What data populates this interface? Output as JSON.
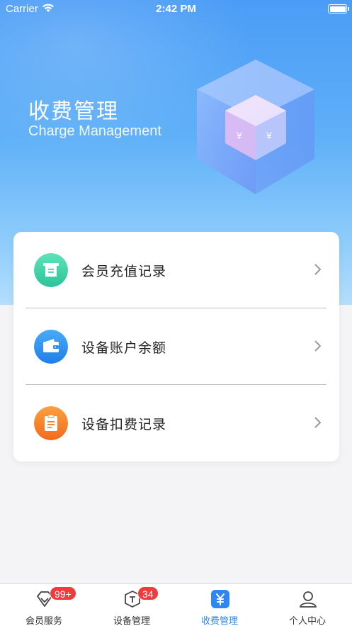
{
  "status_bar": {
    "carrier": "Carrier",
    "time": "2:42 PM"
  },
  "hero": {
    "title": "收费管理",
    "subtitle": "Charge Management",
    "cube_symbol": "¥"
  },
  "menu": {
    "items": [
      {
        "label": "会员充值记录",
        "icon": "receipt-icon",
        "color": "#3fd0a4"
      },
      {
        "label": "设备账户余额",
        "icon": "wallet-icon",
        "color": "#2e8ff0"
      },
      {
        "label": "设备扣费记录",
        "icon": "clipboard-icon",
        "color": "#f7842a"
      }
    ]
  },
  "tabbar": {
    "tabs": [
      {
        "label": "会员服务",
        "icon": "diamond-icon",
        "badge": "99+"
      },
      {
        "label": "设备管理",
        "icon": "device-icon",
        "badge": "34"
      },
      {
        "label": "收费管理",
        "icon": "yen-icon",
        "active": true
      },
      {
        "label": "个人中心",
        "icon": "user-icon"
      }
    ],
    "active_color": "#2f86f0",
    "badge_color": "#f23a3a"
  }
}
